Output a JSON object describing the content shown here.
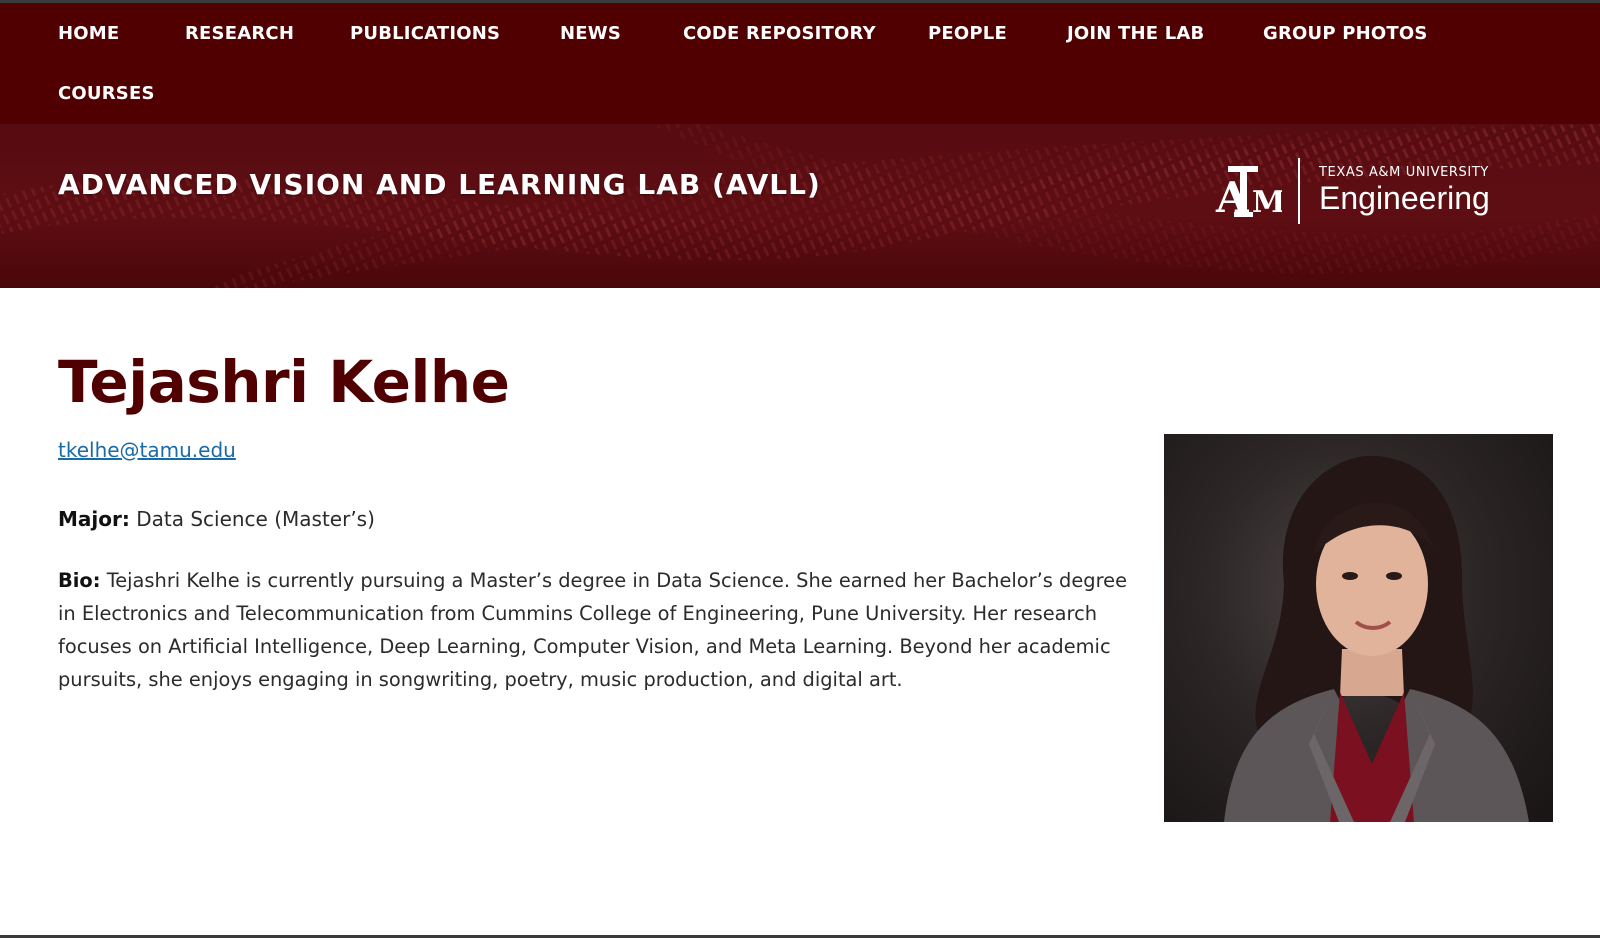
{
  "nav": {
    "items": [
      {
        "label": "HOME"
      },
      {
        "label": "RESEARCH"
      },
      {
        "label": "PUBLICATIONS"
      },
      {
        "label": "NEWS"
      },
      {
        "label": "CODE REPOSITORY"
      },
      {
        "label": "PEOPLE"
      },
      {
        "label": "JOIN THE LAB"
      },
      {
        "label": "GROUP PHOTOS"
      },
      {
        "label": "COURSES"
      }
    ]
  },
  "banner": {
    "title": "ADVANCED VISION AND LEARNING LAB (AVLL)",
    "brand_university": "TEXAS A&M UNIVERSITY",
    "brand_college": "Engineering",
    "logo_text": "ATM"
  },
  "profile": {
    "name": "Tejashri Kelhe",
    "email": "tkelhe@tamu.edu",
    "major_label": "Major:",
    "major_value": "Data Science (Master’s)",
    "bio_label": "Bio:",
    "bio_text": "Tejashri Kelhe is currently pursuing a Master’s degree in Data Science. She earned her Bachelor’s degree in Electronics and Telecommunication from Cummins College of Engineering, Pune University. Her research focuses on Artificial Intelligence, Deep Learning, Computer Vision, and Meta Learning. Beyond her academic pursuits, she enjoys engaging in songwriting, poetry, music production, and digital art."
  },
  "colors": {
    "maroon": "#500000",
    "link": "#1a6aa6",
    "text": "#2b2b2b"
  }
}
